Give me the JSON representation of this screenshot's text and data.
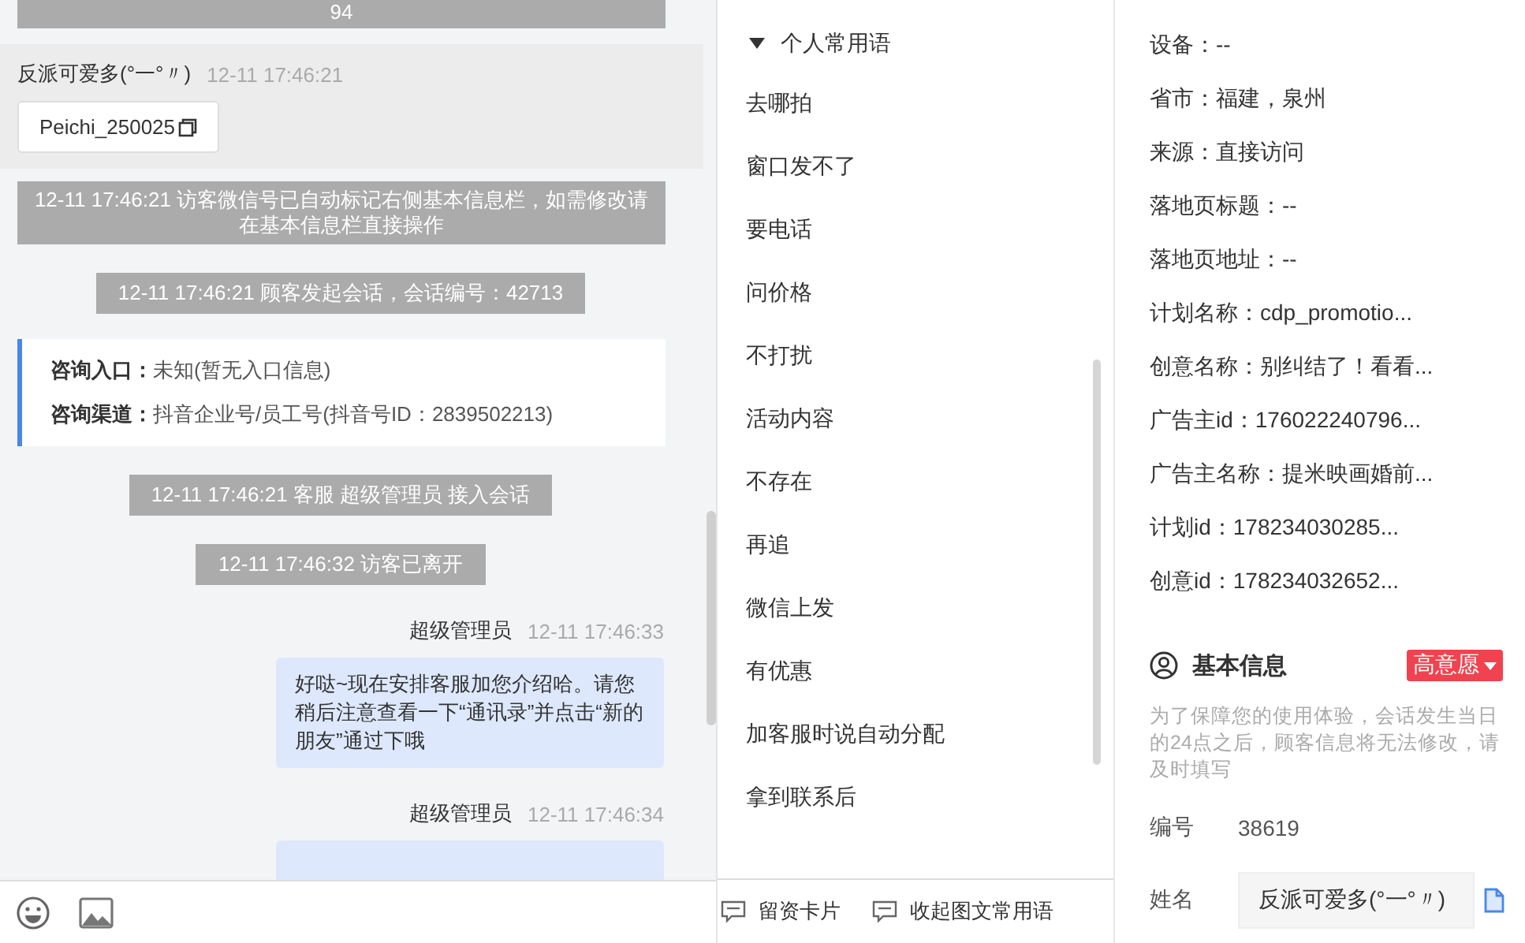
{
  "chat": {
    "messages": [
      {
        "kind": "notice",
        "text": "94"
      },
      {
        "kind": "visitor",
        "sender": "反派可爱多(°一°〃)",
        "time": "12-11 17:46:21",
        "card": "Peichi_250025"
      },
      {
        "kind": "notice",
        "text": "12-11 17:46:21 访客微信号已自动标记右侧基本信息栏，如需修改请在基本信息栏直接操作"
      },
      {
        "kind": "system",
        "text": "12-11 17:46:21 顾客发起会话，会话编号：42713"
      },
      {
        "kind": "info",
        "fields": [
          {
            "label": "咨询入口：",
            "value": "未知(暂无入口信息)"
          },
          {
            "label": "咨询渠道：",
            "value": "抖音企业号/员工号(抖音号ID：2839502213)"
          }
        ]
      },
      {
        "kind": "system",
        "text": "12-11 17:46:21 客服 超级管理员 接入会话"
      },
      {
        "kind": "system",
        "text": "12-11 17:46:32 访客已离开"
      },
      {
        "kind": "agent",
        "sender": "超级管理员",
        "time": "12-11 17:46:33",
        "text": "好哒~现在安排客服加您介绍哈。请您稍后注意查看一下“通讯录”并点击“新的朋友”通过下哦"
      },
      {
        "kind": "agent",
        "sender": "超级管理员",
        "time": "12-11 17:46:34"
      }
    ]
  },
  "phrases": {
    "group": {
      "title": "个人常用语",
      "expanded": true
    },
    "items": [
      "去哪拍",
      "窗口发不了",
      "要电话",
      "问价格",
      "不打扰",
      "活动内容",
      "不存在",
      "再追",
      "微信上发",
      "有优惠",
      "加客服时说自动分配",
      "拿到联系后"
    ]
  },
  "phrase_actions": [
    "留资卡片",
    "收起图文常用语"
  ],
  "visitor_info": [
    "设备：--",
    "省市：福建，泉州",
    "来源：直接访问",
    "落地页标题：--",
    "落地页地址：--",
    "计划名称：cdp_promotio...",
    "创意名称：别纠结了！看看...",
    "广告主id：176022240796...",
    "广告主名称：提米映画婚前...",
    "计划id：178234030285...",
    "创意id：178234032652..."
  ],
  "basic_info": {
    "title": "基本信息",
    "intent_badge": "高意愿",
    "note": "为了保障您的使用体验，会话发生当日的24点之后，顾客信息将无法修改，请及时填写",
    "fields": [
      {
        "kind": "text",
        "label": "编号",
        "value": "38619"
      },
      {
        "kind": "input",
        "label": "姓名",
        "value": "反派可爱多(°一°〃)"
      }
    ]
  }
}
